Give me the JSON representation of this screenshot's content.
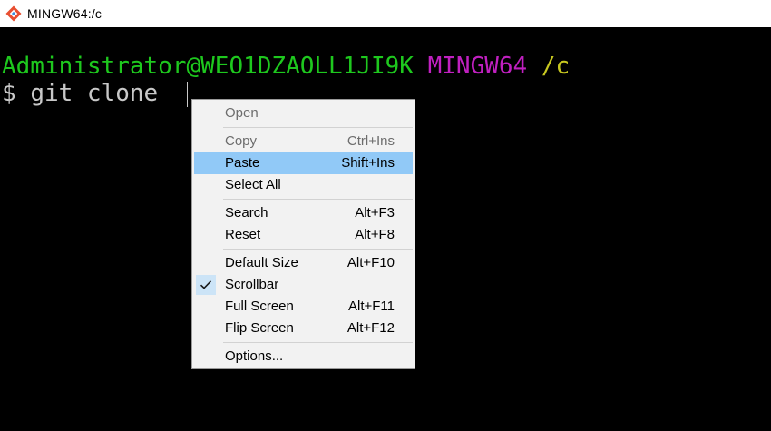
{
  "window": {
    "title": "MINGW64:/c",
    "icon": "git-bash-icon"
  },
  "terminal": {
    "user_host": "Administrator@WEO1DZAOLL1JI9K",
    "env": "MINGW64",
    "path": "/c",
    "prompt_symbol": "$",
    "command": "git clone",
    "colors": {
      "background": "#000000",
      "user_host": "#1ec81e",
      "env": "#c020c0",
      "path": "#c8c820",
      "text": "#c8c8c8"
    }
  },
  "context_menu": {
    "open": {
      "label": "Open",
      "enabled": false
    },
    "copy": {
      "label": "Copy",
      "shortcut": "Ctrl+Ins",
      "enabled": false
    },
    "paste": {
      "label": "Paste",
      "shortcut": "Shift+Ins",
      "highlighted": true
    },
    "select_all": {
      "label": "Select All"
    },
    "search": {
      "label": "Search",
      "shortcut": "Alt+F3"
    },
    "reset": {
      "label": "Reset",
      "shortcut": "Alt+F8"
    },
    "default_size": {
      "label": "Default Size",
      "shortcut": "Alt+F10"
    },
    "scrollbar": {
      "label": "Scrollbar",
      "checked": true,
      "check_icon": "checkmark-icon"
    },
    "full_screen": {
      "label": "Full Screen",
      "shortcut": "Alt+F11"
    },
    "flip_screen": {
      "label": "Flip Screen",
      "shortcut": "Alt+F12"
    },
    "options": {
      "label": "Options..."
    },
    "highlight_color": "#91c9f7"
  }
}
